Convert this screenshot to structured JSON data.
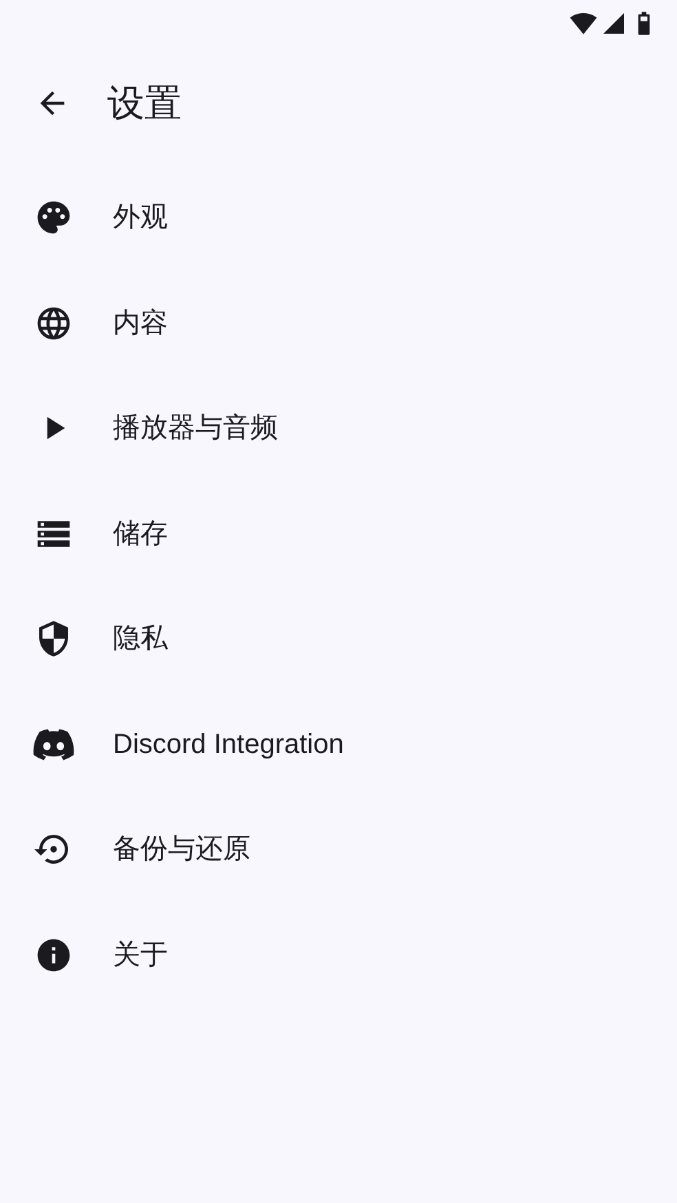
{
  "header": {
    "title": "设置"
  },
  "items": [
    {
      "label": "外观"
    },
    {
      "label": "内容"
    },
    {
      "label": "播放器与音频"
    },
    {
      "label": "储存"
    },
    {
      "label": "隐私"
    },
    {
      "label": "Discord Integration"
    },
    {
      "label": "备份与还原"
    },
    {
      "label": "关于"
    }
  ]
}
